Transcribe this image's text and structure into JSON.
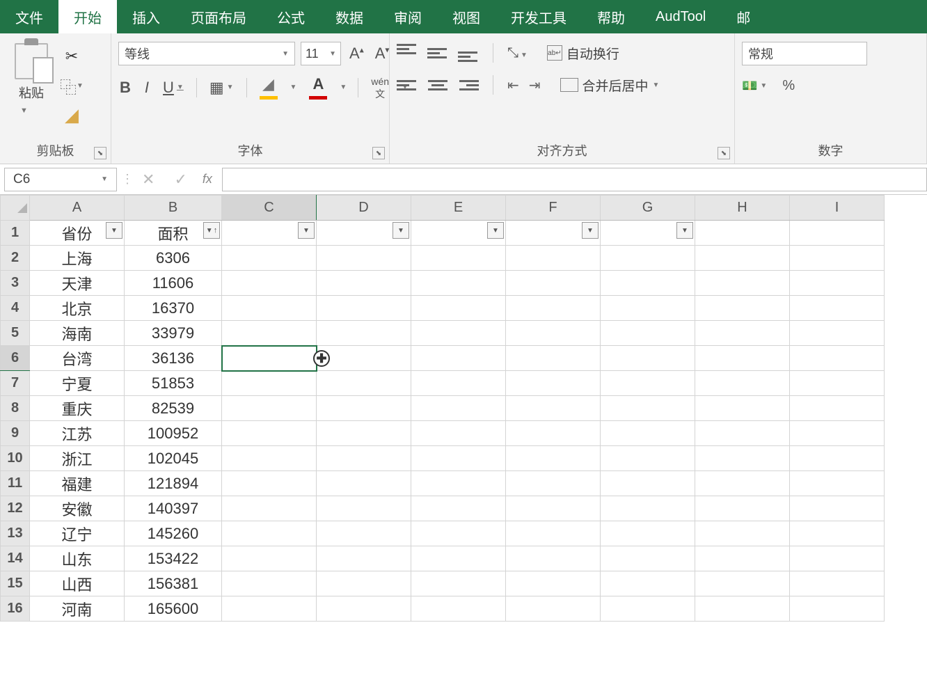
{
  "tabs": {
    "file": "文件",
    "home": "开始",
    "insert": "插入",
    "layout": "页面布局",
    "formulas": "公式",
    "data": "数据",
    "review": "审阅",
    "view": "视图",
    "dev": "开发工具",
    "help": "帮助",
    "audtool": "AudTool",
    "mail": "邮"
  },
  "ribbon": {
    "clipboard": {
      "paste": "粘贴",
      "label": "剪贴板"
    },
    "font": {
      "name": "等线",
      "size": "11",
      "btn_wen_top": "wén",
      "btn_wen_bot": "文",
      "label": "字体"
    },
    "alignment": {
      "wrap_icon_text": "ab",
      "wrap": "自动换行",
      "merge": "合并后居中",
      "label": "对齐方式"
    },
    "number": {
      "format": "常规",
      "percent": "%",
      "label": "数字"
    }
  },
  "formula_bar": {
    "cell_ref": "C6",
    "fx": "fx",
    "value": ""
  },
  "columns": [
    "A",
    "B",
    "C",
    "D",
    "E",
    "F",
    "G",
    "H",
    "I"
  ],
  "headers": {
    "a": "省份",
    "b": "面积"
  },
  "rows": [
    {
      "n": 1,
      "a": "省份",
      "b": "面积",
      "hdr": true
    },
    {
      "n": 2,
      "a": "上海",
      "b": "6306"
    },
    {
      "n": 3,
      "a": "天津",
      "b": "11606"
    },
    {
      "n": 4,
      "a": "北京",
      "b": "16370"
    },
    {
      "n": 5,
      "a": "海南",
      "b": "33979"
    },
    {
      "n": 6,
      "a": "台湾",
      "b": "36136",
      "sel": true
    },
    {
      "n": 7,
      "a": "宁夏",
      "b": "51853"
    },
    {
      "n": 8,
      "a": "重庆",
      "b": "82539"
    },
    {
      "n": 9,
      "a": "江苏",
      "b": "100952"
    },
    {
      "n": 10,
      "a": "浙江",
      "b": "102045"
    },
    {
      "n": 11,
      "a": "福建",
      "b": "121894"
    },
    {
      "n": 12,
      "a": "安徽",
      "b": "140397"
    },
    {
      "n": 13,
      "a": "辽宁",
      "b": "145260"
    },
    {
      "n": 14,
      "a": "山东",
      "b": "153422"
    },
    {
      "n": 15,
      "a": "山西",
      "b": "156381"
    },
    {
      "n": 16,
      "a": "河南",
      "b": "165600"
    }
  ],
  "col_widths": {
    "row": 42,
    "A": 136,
    "B": 140,
    "C": 136,
    "D": 136,
    "E": 136,
    "F": 136,
    "G": 136,
    "H": 136,
    "I": 136
  },
  "selected": "C6"
}
